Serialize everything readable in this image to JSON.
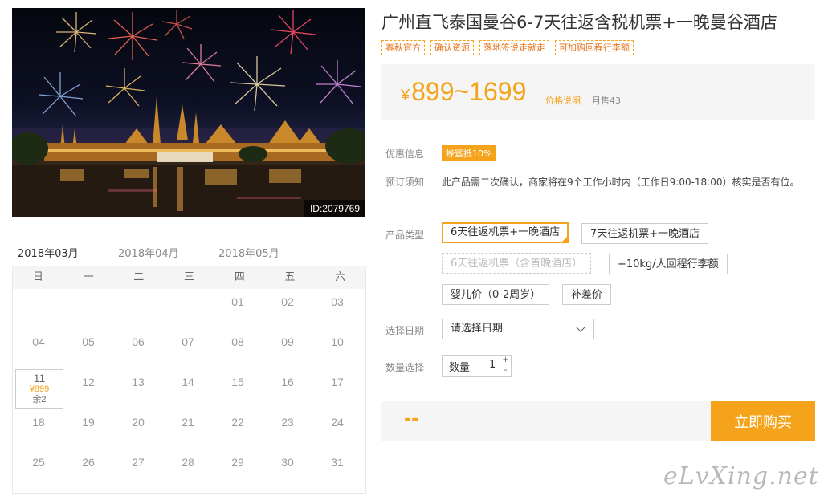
{
  "product": {
    "image_id": "ID:2079769",
    "title": "广州直飞泰国曼谷6-7天往返含税机票+一晚曼谷酒店",
    "tags": [
      "春秋官方",
      "确认资源",
      "落地签说走就走",
      "可加购回程行李额"
    ]
  },
  "price": {
    "currency": "¥",
    "range": "899~1699",
    "explain_link": "价格说明",
    "sold": "月售43"
  },
  "promo": {
    "label": "优惠信息",
    "badge": "蜂蜜抵10%"
  },
  "notice": {
    "label": "预订须知",
    "text": "此产品需二次确认，商家将在9个工作小时内（工作日9:00-18:00）核实是否有位。"
  },
  "product_type": {
    "label": "产品类型",
    "options": [
      "6天往返机票+一晚酒店",
      "7天往返机票+一晚酒店",
      "6天往返机票（含首晚酒店）",
      "+10kg/人回程行李额",
      "婴儿价（0-2周岁）",
      "补差价"
    ]
  },
  "date_select": {
    "label": "选择日期",
    "placeholder": "请选择日期"
  },
  "quantity": {
    "label": "数量选择",
    "field_label": "数量",
    "value": "1",
    "plus": "+",
    "minus": "-"
  },
  "purchase": {
    "total": "--",
    "buy_label": "立即购买"
  },
  "calendar": {
    "months": [
      "2018年03月",
      "2018年04月",
      "2018年05月"
    ],
    "weekdays": [
      "日",
      "一",
      "二",
      "三",
      "四",
      "五",
      "六"
    ],
    "days": [
      "01",
      "02",
      "03",
      "04",
      "05",
      "06",
      "07",
      "08",
      "09",
      "10",
      "11",
      "12",
      "13",
      "14",
      "15",
      "16",
      "17",
      "18",
      "19",
      "20",
      "21",
      "22",
      "23",
      "24",
      "25",
      "26",
      "27",
      "28",
      "29",
      "30",
      "31"
    ],
    "avail_price": "¥899",
    "avail_remain": "余2"
  },
  "watermark": "eLvXing.net",
  "colors": {
    "accent": "#f5a31a",
    "tag_text": "#e8731a"
  }
}
